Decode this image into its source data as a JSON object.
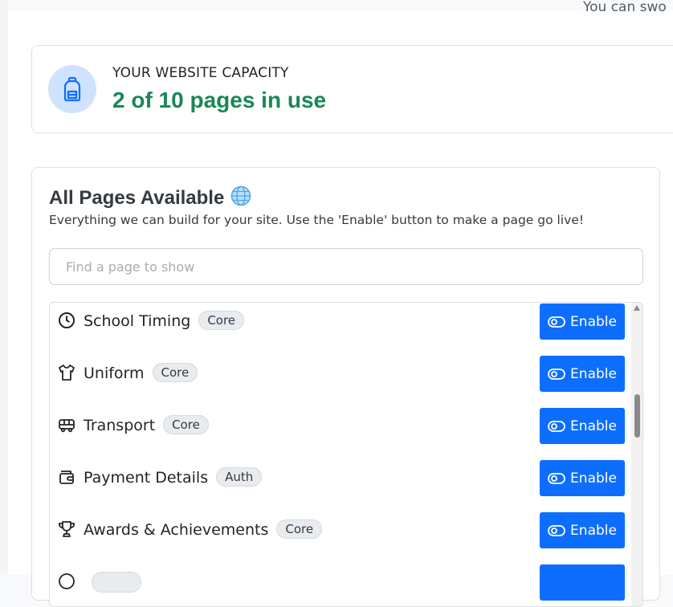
{
  "top_hint": "You can swo",
  "capacity": {
    "label": "YOUR WEBSITE CAPACITY",
    "value": "2 of 10 pages in use",
    "icon": "backpack-icon",
    "used": 2,
    "total": 10
  },
  "pages": {
    "title": "All Pages Available",
    "title_icon": "globe-icon",
    "subtitle": "Everything we can build for your site. Use the 'Enable' button to make a page go live!",
    "search_placeholder": "Find a page to show",
    "items": [
      {
        "name": "School Timing",
        "badge": "Core",
        "icon": "clock-icon",
        "button": "Enable"
      },
      {
        "name": "Uniform",
        "badge": "Core",
        "icon": "shirt-icon",
        "button": "Enable"
      },
      {
        "name": "Transport",
        "badge": "Core",
        "icon": "bus-icon",
        "button": "Enable"
      },
      {
        "name": "Payment Details",
        "badge": "Auth",
        "icon": "wallet-icon",
        "button": "Enable"
      },
      {
        "name": "Awards & Achievements",
        "badge": "Core",
        "icon": "trophy-icon",
        "button": "Enable"
      },
      {
        "name": "",
        "badge": "",
        "icon": "generic-icon",
        "button": ""
      }
    ]
  },
  "colors": {
    "accent": "#0d6efd",
    "success": "#198754",
    "icon_bg": "#cfe2ff"
  }
}
